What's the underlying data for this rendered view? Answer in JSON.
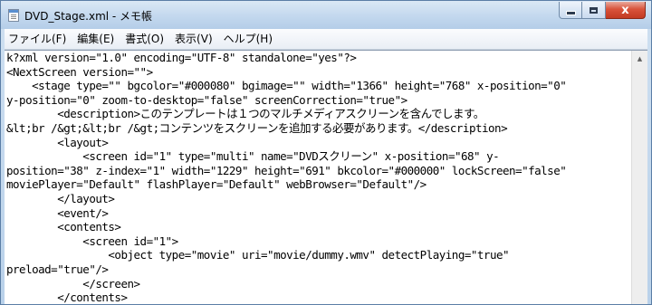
{
  "window": {
    "title": "DVD_Stage.xml - メモ帳"
  },
  "caption_buttons": {
    "close_glyph": "x"
  },
  "menu": {
    "items": [
      "ファイル(F)",
      "編集(E)",
      "書式(O)",
      "表示(V)",
      "ヘルプ(H)"
    ]
  },
  "editor": {
    "lines": [
      "k?xml version=\"1.0\" encoding=\"UTF-8\" standalone=\"yes\"?>",
      "<NextScreen version=\"\">",
      "    <stage type=\"\" bgcolor=\"#000080\" bgimage=\"\" width=\"1366\" height=\"768\" x-position=\"0\"",
      "y-position=\"0\" zoom-to-desktop=\"false\" screenCorrection=\"true\">",
      "        <description>このテンプレートは１つのマルチメディアスクリーンを含んでします。",
      "&lt;br /&gt;&lt;br /&gt;コンテンツをスクリーンを追加する必要があります。</description>",
      "        <layout>",
      "            <screen id=\"1\" type=\"multi\" name=\"DVDスクリーン\" x-position=\"68\" y-",
      "position=\"38\" z-index=\"1\" width=\"1229\" height=\"691\" bkcolor=\"#000000\" lockScreen=\"false\"",
      "moviePlayer=\"Default\" flashPlayer=\"Default\" webBrowser=\"Default\"/>",
      "        </layout>",
      "        <event/>",
      "        <contents>",
      "            <screen id=\"1\">",
      "                <object type=\"movie\" uri=\"movie/dummy.wmv\" detectPlaying=\"true\"",
      "preload=\"true\"/>",
      "            </screen>",
      "        </contents>"
    ]
  },
  "scrollbar": {
    "up_arrow": "▲"
  },
  "colors": {
    "titlebar": "#c3d8ee",
    "close_button": "#d9533b",
    "editor_background": "#ffffff",
    "text": "#000000"
  }
}
